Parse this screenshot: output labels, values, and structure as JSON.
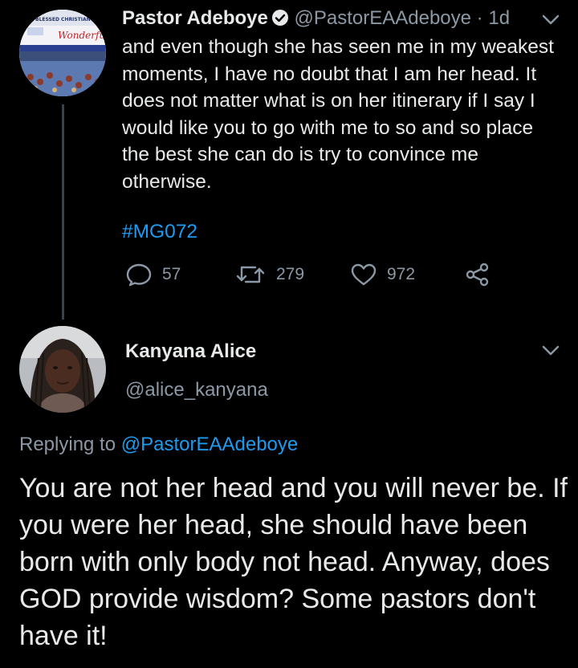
{
  "tweet": {
    "author_name": "Pastor Adeboye",
    "author_handle": "@PastorEAAdeboye",
    "separator": "·",
    "timestamp": "1d",
    "text": "and even though she has seen me in my weakest moments, I have no doubt that I am her head. It does not matter what is on her itinerary if I say I would like you to go with me to so and so place the best she can do is try to convince me otherwise.",
    "hashtag": "#MG072",
    "reply_count": "57",
    "retweet_count": "279",
    "like_count": "972",
    "avatar_text": "Wonderful",
    "avatar_caption": "BLESSED CHRISTIAN CH"
  },
  "reply": {
    "author_name": "Kanyana Alice",
    "author_handle": "@alice_kanyana",
    "replying_prefix": "Replying to",
    "replying_to": "@PastorEAAdeboye",
    "text": "You are not her head and you will never be. If you were her head, she should have been born with only body not head. Anyway, does GOD provide wisdom? Some pastors don't have it!"
  },
  "colors": {
    "background": "#000000",
    "text": "#e7e9ea",
    "secondary": "#8b98a5",
    "accent": "#1d9bf0",
    "thread_line": "#38444d"
  },
  "icons": [
    "verified-icon",
    "chevron-down-icon",
    "reply-icon",
    "retweet-icon",
    "like-icon",
    "share-icon"
  ]
}
